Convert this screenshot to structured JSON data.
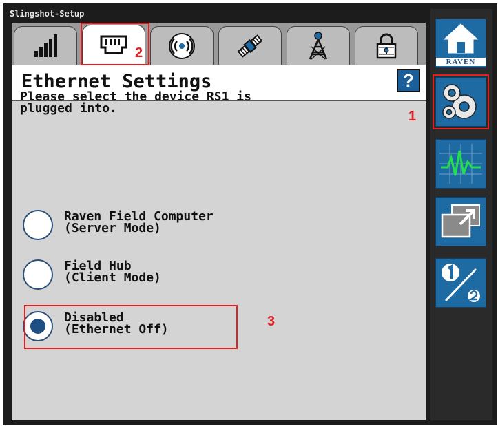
{
  "window": {
    "title": "Slingshot-Setup"
  },
  "tabs": [
    {
      "icon": "signal-bars-icon",
      "active": false
    },
    {
      "icon": "ethernet-port-icon",
      "active": true
    },
    {
      "icon": "wireless-broadcast-icon",
      "active": false
    },
    {
      "icon": "satellite-icon",
      "active": false
    },
    {
      "icon": "radio-tower-icon",
      "active": false
    },
    {
      "icon": "padlock-icon",
      "active": false
    }
  ],
  "header": {
    "title": "Ethernet Settings",
    "help_label": "?"
  },
  "prompt": "Please select the device RS1 is\nplugged into.",
  "options": [
    {
      "label": "Raven Field Computer\n(Server Mode)",
      "selected": false
    },
    {
      "label": "Field Hub\n(Client Mode)",
      "selected": false
    },
    {
      "label": "Disabled\n(Ethernet Off)",
      "selected": true
    }
  ],
  "sidebar": {
    "home_label": "RAVEN",
    "buttons": [
      "home-icon",
      "settings-gears-icon",
      "diagnostics-waveform-icon",
      "window-expand-icon",
      "one-of-two-icon"
    ]
  },
  "annotations": {
    "one": "1",
    "two": "2",
    "three": "3"
  },
  "colors": {
    "accent": "#1e6aa3",
    "annotation": "#e02020",
    "radio_fill": "#1e4f82"
  }
}
